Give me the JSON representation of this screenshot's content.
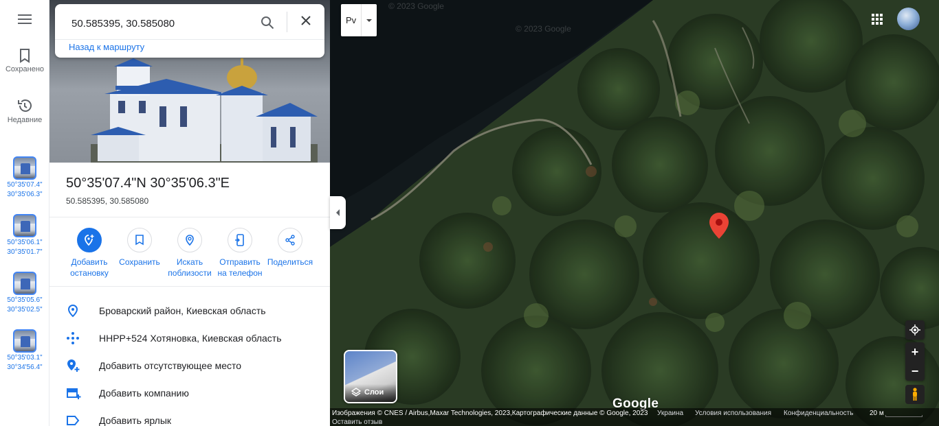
{
  "rail": {
    "saved_label": "Сохранено",
    "recent_label": "Недавние",
    "recent_items": [
      {
        "line1": "50°35'07.4\"",
        "line2": "30°35'06.3\""
      },
      {
        "line1": "50°35'06.1\"",
        "line2": "30°35'01.7\""
      },
      {
        "line1": "50°35'05.6\"",
        "line2": "30°35'02.5\""
      },
      {
        "line1": "50°35'03.1\"",
        "line2": "30°34'56.4\""
      }
    ]
  },
  "search": {
    "value": "50.585395, 30.585080",
    "back_link": "Назад к маршруту"
  },
  "place": {
    "title": "50°35'07.4\"N 30°35'06.3\"E",
    "subtitle": "50.585395, 30.585080"
  },
  "actions": [
    {
      "line1": "Добавить",
      "line2": "остановку"
    },
    {
      "line1": "Сохранить",
      "line2": ""
    },
    {
      "line1": "Искать",
      "line2": "поблизости"
    },
    {
      "line1": "Отправить",
      "line2": "на телефон"
    },
    {
      "line1": "Поделиться",
      "line2": ""
    }
  ],
  "info": [
    {
      "text": "Броварский район, Киевская область",
      "icon": "location-pin-icon"
    },
    {
      "text": "HHPP+524 Хотяновка, Киевская область",
      "icon": "plus-code-icon"
    },
    {
      "text": "Добавить отсутствующее место",
      "icon": "add-place-icon"
    },
    {
      "text": "Добавить компанию",
      "icon": "add-business-icon"
    },
    {
      "text": "Добавить ярлык",
      "icon": "label-icon"
    }
  ],
  "map": {
    "lang_label": "Рv",
    "layers_label": "Слои",
    "logo": "Google",
    "watermark": "© 2023 Google",
    "attribution": "Изображения © CNES / Airbus,Maxar Technologies, 2023,Картографические данные © Google, 2023",
    "country": "Украина",
    "terms": "Условия использования",
    "privacy": "Конфиденциальность",
    "scale": "20 м",
    "feedback": "Оставить отзыв"
  },
  "colors": {
    "accent": "#1a73e8",
    "pin": "#ea4335"
  }
}
